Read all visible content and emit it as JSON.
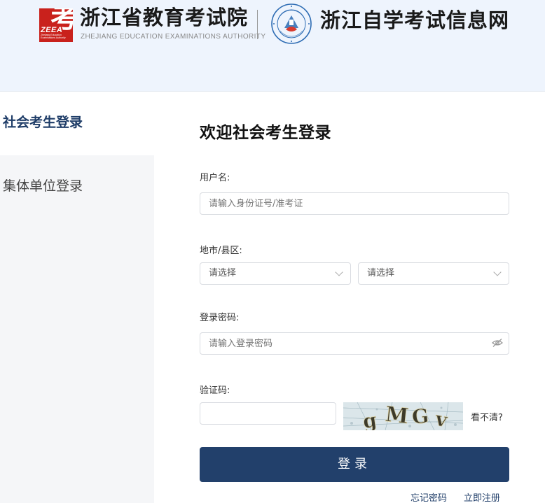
{
  "header": {
    "org_name": "浙江省教育考试院",
    "org_name_en": "ZHEJIANG EDUCATION EXAMINATIONS AUTHORITY",
    "logo_char": "考",
    "logo_text": "ZEEA",
    "logo_small_1": "Zhejiang Education",
    "logo_small_2": "Examinations Authority",
    "site_title": "浙江自学考试信息网",
    "colors": {
      "logo_red": "#c9211c",
      "header_bg": "#eef4fd",
      "accent": "#22406b"
    }
  },
  "sidebar": {
    "tabs": [
      {
        "label": "社会考生登录",
        "active": true
      },
      {
        "label": "集体单位登录",
        "active": false
      }
    ]
  },
  "form": {
    "title": "欢迎社会考生登录",
    "username": {
      "label": "用户名:",
      "placeholder": "请输入身份证号/准考证"
    },
    "region": {
      "label": "地市/县区:",
      "city_value": "请选择",
      "district_value": "请选择"
    },
    "password": {
      "label": "登录密码:",
      "placeholder": "请输入登录密码"
    },
    "captcha": {
      "label": "验证码:",
      "value": "",
      "image_text": "gMGv",
      "refresh_label": "看不清?"
    },
    "submit_label": "登录",
    "forgot_label": "忘记密码",
    "register_label": "立即注册"
  }
}
